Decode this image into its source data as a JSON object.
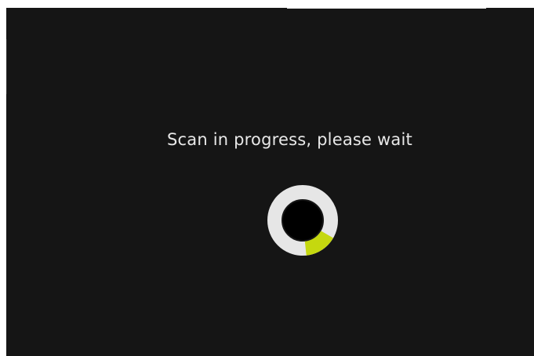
{
  "status": {
    "message": "Scan in progress, please wait"
  },
  "spinner": {
    "icon": "loading-spinner-icon",
    "track_color": "#e6e6e6",
    "center_color": "#000000",
    "arc_color": "#c5d80f",
    "progress_fraction": 0.15
  },
  "colors": {
    "background": "#151515",
    "text": "#e8e8e8"
  }
}
